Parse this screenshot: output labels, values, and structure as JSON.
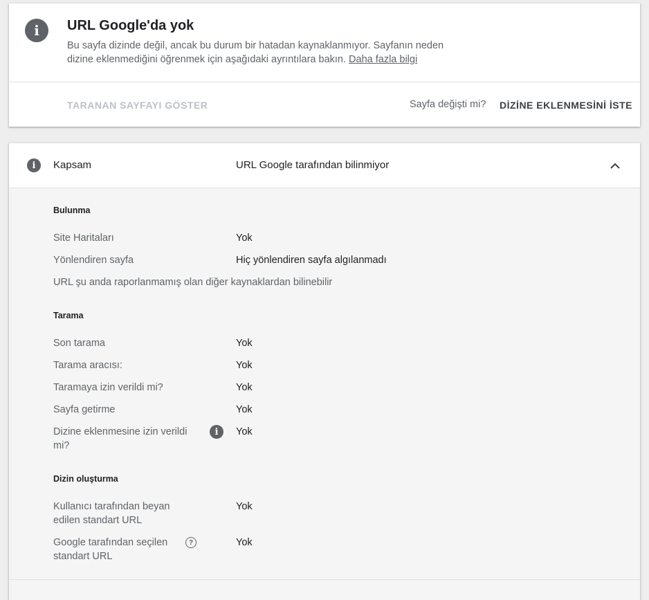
{
  "status": {
    "icon": "info-icon",
    "title": "URL Google'da yok",
    "description": "Bu sayfa dizinde değil, ancak bu durum bir hatadan kaynaklanmıyor. Sayfanın neden dizine eklenmediğini öğrenmek için aşağıdaki ayrıntılara bakın.",
    "learn_more": "Daha fazla bilgi",
    "view_crawled_label": "TARANAN SAYFAYI GÖSTER",
    "changed_question": "Sayfa değişti mi?",
    "request_index_label": "DİZİNE EKLENMESİNİ İSTE"
  },
  "coverage": {
    "label": "Kapsam",
    "value": "URL Google tarafından bilinmiyor",
    "sections": {
      "discovery": {
        "title": "Bulunma",
        "sitemaps_label": "Site Haritaları",
        "sitemaps_value": "Yok",
        "referring_label": "Yönlendiren sayfa",
        "referring_value": "Hiç yönlendiren sayfa algılanmadı",
        "note": "URL şu anda raporlanmamış olan diğer kaynaklardan bilinebilir"
      },
      "crawl": {
        "title": "Tarama",
        "last_crawl_label": "Son tarama",
        "last_crawl_value": "Yok",
        "crawler_label": "Tarama aracısı:",
        "crawler_value": "Yok",
        "crawl_allowed_label": "Taramaya izin verildi mi?",
        "crawl_allowed_value": "Yok",
        "page_fetch_label": "Sayfa getirme",
        "page_fetch_value": "Yok",
        "index_allowed_label": "Dizine eklenmesine izin verildi mi?",
        "index_allowed_value": "Yok"
      },
      "indexing": {
        "title": "Dizin oluşturma",
        "user_canonical_label": "Kullanıcı tarafından beyan edilen standart URL",
        "user_canonical_value": "Yok",
        "google_canonical_label": "Google tarafından seçilen standart URL",
        "google_canonical_value": "Yok"
      }
    }
  }
}
